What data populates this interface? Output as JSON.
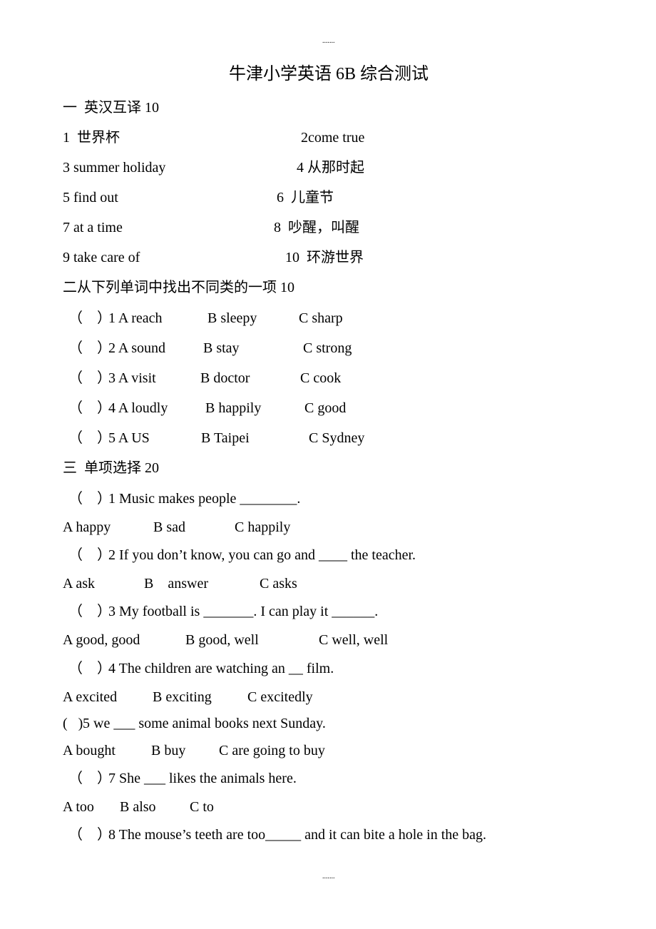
{
  "header_marker": ".......",
  "footer_marker": ".......",
  "title": "牛津小学英语 6B 综合测试",
  "section1": {
    "heading": "一  英汉互译 10",
    "items": [
      {
        "left": "1  世界杯",
        "right": "2come true"
      },
      {
        "left": "3 summer holiday",
        "right": "4 从那时起"
      },
      {
        "left": "5 find out",
        "right": "6  儿童节"
      },
      {
        "left": "7 at a time",
        "right": "8  吵醒，叫醒"
      },
      {
        "left": "9 take care of",
        "right": "10  环游世界"
      }
    ]
  },
  "section2": {
    "heading": "二从下列单词中找出不同类的一项 10",
    "items": [
      {
        "bracket": "（    ）",
        "num_a": "1 A reach",
        "b": "B sleepy",
        "c": "C sharp"
      },
      {
        "bracket": "（    ）",
        "num_a": "2 A sound",
        "b": "B stay",
        "c": "C strong"
      },
      {
        "bracket": "（    ）",
        "num_a": "3 A visit",
        "b": "B doctor",
        "c": "C cook"
      },
      {
        "bracket": "（    ）",
        "num_a": "4 A loudly",
        "b": "B happily",
        "c": "C good"
      },
      {
        "bracket": "（    ）",
        "num_a": "5 A US",
        "b": "B Taipei",
        "c": "C Sydney"
      }
    ]
  },
  "section3": {
    "heading": "三  单项选择 20",
    "questions": [
      {
        "bracket": "（    ）",
        "text": "1 Music makes people ________.",
        "options": [
          "A happy",
          "B sad",
          "C happily"
        ]
      },
      {
        "bracket": "（    ）",
        "text": "2 If you don’t know, you can go and ____ the teacher.",
        "options": [
          "A ask",
          "B    answer",
          "C asks"
        ]
      },
      {
        "bracket": "（    ）",
        "text": "3 My football is _______. I can play it ______.",
        "options": [
          "A good, good",
          "B good, well",
          "C well, well"
        ]
      },
      {
        "bracket": "（    ）",
        "text": "4 The children are watching an __ film.",
        "options": [
          "A excited",
          "B exciting",
          "C excitedly"
        ]
      },
      {
        "bracket": "(   )",
        "text": "5 we ___ some animal books next Sunday.",
        "options": [
          "A bought",
          "B buy",
          "C are going to buy"
        ]
      },
      {
        "bracket": "（    ）",
        "text": "7 She ___ likes the animals here.",
        "options": [
          "A too",
          "B also",
          "C to"
        ]
      },
      {
        "bracket": "（    ）",
        "text": "8 The mouse’s teeth are too_____ and it can bite a hole in the bag.",
        "options": []
      }
    ]
  }
}
